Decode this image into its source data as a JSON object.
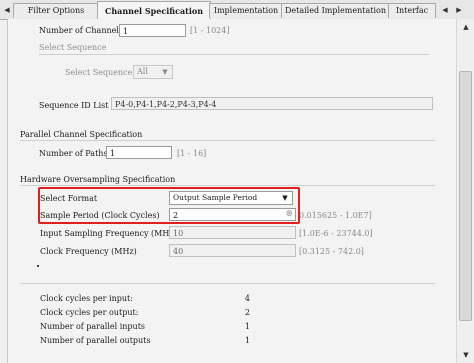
{
  "tabs": [
    {
      "label": "Filter Options",
      "active": false
    },
    {
      "label": "Channel Specification",
      "active": true
    },
    {
      "label": "Implementation",
      "active": false
    },
    {
      "label": "Detailed Implementation",
      "active": false
    },
    {
      "label": "Interfac",
      "active": false
    }
  ],
  "nav": {
    "left": "◀",
    "right": "▶"
  },
  "channels": {
    "label": "Number of Channels",
    "value": "1",
    "range": "[1 - 1024]"
  },
  "sequence": {
    "title": "Select Sequence",
    "select_label": "Select Sequence",
    "select_value": "All",
    "id_list_label": "Sequence ID List",
    "id_list_value": "P4-0,P4-1,P4-2,P4-3,P4-4"
  },
  "parallel": {
    "title": "Parallel Channel Specification",
    "paths_label": "Number of Paths",
    "paths_value": "1",
    "paths_range": "[1 - 16]"
  },
  "oversampling": {
    "title": "Hardware Oversampling Specification",
    "format_label": "Select Format",
    "format_value": "Output Sample Period",
    "period_label": "Sample Period (Clock Cycles)",
    "period_value": "2",
    "period_range": "0.015625 - 1.0E7]",
    "input_freq_label": "Input Sampling Frequency (MHz)",
    "input_freq_value": "10",
    "input_freq_range": "[1.0E-6 - 23744.0]",
    "clock_label": "Clock Frequency (MHz)",
    "clock_value": "40",
    "clock_range": "[0.3125 - 742.0]"
  },
  "summary": [
    {
      "label": "Clock cycles per input:",
      "value": "4"
    },
    {
      "label": "Clock cycles per output:",
      "value": "2"
    },
    {
      "label": "Number of parallel inputs",
      "value": "1"
    },
    {
      "label": "Number of parallel outputs",
      "value": "1"
    }
  ],
  "colors": {
    "highlight": "#e0201f"
  },
  "icons": {
    "clear": "⊗",
    "dropdown": "▼",
    "up": "▲",
    "down": "▼"
  }
}
